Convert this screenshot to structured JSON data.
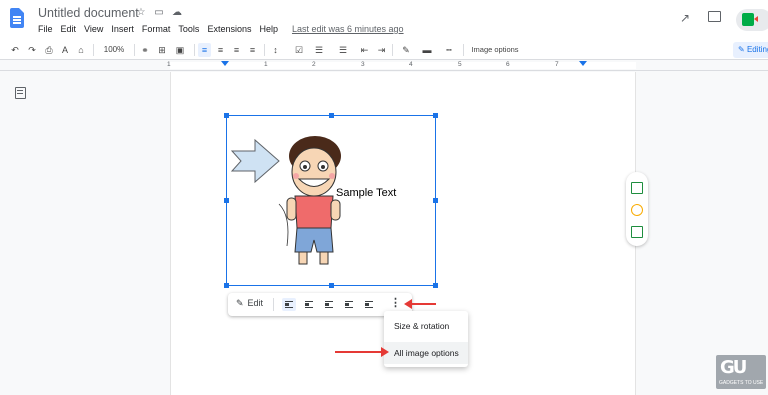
{
  "document": {
    "title": "Untitled document",
    "menus": [
      "File",
      "Edit",
      "View",
      "Insert",
      "Format",
      "Tools",
      "Extensions",
      "Help"
    ],
    "last_edit": "Last edit was 6 minutes ago"
  },
  "toolbar": {
    "zoom": "100%",
    "image_options_label": "Image options",
    "mode_label": "Editing"
  },
  "ruler": {
    "numbers": [
      "1",
      "1",
      "2",
      "3",
      "4",
      "5",
      "6",
      "7"
    ]
  },
  "canvas": {
    "sample_text": "Sample Text"
  },
  "image_toolbar": {
    "edit_label": "Edit",
    "wrap_buttons": [
      "In line",
      "Wrap text",
      "Break text",
      "Behind text",
      "In front of text"
    ]
  },
  "context_menu": {
    "items": [
      "Size & rotation",
      "All image options"
    ]
  },
  "watermark": {
    "logo": "GU",
    "text": "GADGETS TO USE"
  },
  "colors": {
    "accent": "#1a73e8",
    "selection": "#e8f0fe",
    "annotation": "#e53935"
  }
}
